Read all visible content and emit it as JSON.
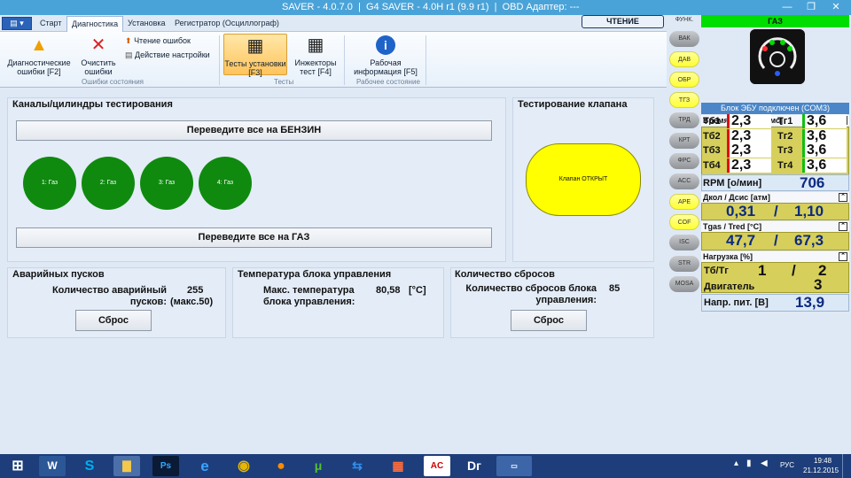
{
  "window": {
    "title": "SAVER - 4.0.7.0  |  G4 SAVER - 4.0H r1 (9.9 r1)  |  OBD Адаптер: ---"
  },
  "tabs": [
    "Старт",
    "Диагностика",
    "Установка",
    "Регистратор (Осциллограф)"
  ],
  "read_button": "ЧТЕНИЕ",
  "ribbon": {
    "diag_errors": "Диагностические ошибки [F2]",
    "clear_errors": "Очистить ошибки",
    "read_errors": "Чтение ошибок",
    "action_settings": "Действие настройки",
    "group_errors": "Ошибки состояния",
    "tests_install": "Тесты установки [F3]",
    "injectors_test": "Инжекторы тест [F4]",
    "group_tests": "Тесты",
    "work_info": "Рабочая информация [F5]",
    "group_work": "Рабочее состояние"
  },
  "channels": {
    "title": "Каналы/цилиндры тестирования",
    "to_petrol": "Переведите все на БЕНЗИН",
    "to_gas": "Переведите все на ГАЗ",
    "cylinders": [
      "1: Газ",
      "2: Газ",
      "3: Газ",
      "4: Газ"
    ],
    "cylinder_color": "#0f8a0f"
  },
  "valve": {
    "title": "Тестирование клапана",
    "state": "Клапан ОТКРЫТ",
    "color": "#ffff00"
  },
  "emergency": {
    "title": "Аварийных пусков",
    "label": "Количество аварийный пусков:",
    "value": "255",
    "max": "(макс.50)",
    "reset": "Сброс"
  },
  "temperature": {
    "title": "Температура блока управления",
    "label": "Макс. температура блока управления:",
    "value": "80,58",
    "unit": "[°C]"
  },
  "resets": {
    "title": "Количество сбросов",
    "label": "Количество сбросов блока управления:",
    "value": "85",
    "reset": "Сброс"
  },
  "side_buttons": [
    {
      "label": "ФУНК.",
      "style": "plain"
    },
    {
      "label": "ВАК",
      "style": "gray"
    },
    {
      "label": "ДАВ",
      "style": "yellow"
    },
    {
      "label": "ОБР",
      "style": "yellow"
    },
    {
      "label": "ТГЗ",
      "style": "yellow"
    },
    {
      "label": "ТРД",
      "style": "gray"
    },
    {
      "label": "КРТ",
      "style": "gray"
    },
    {
      "label": "ФРС",
      "style": "gray"
    },
    {
      "label": "АСС",
      "style": "gray"
    },
    {
      "label": "АРЕ",
      "style": "yellow"
    },
    {
      "label": "COF",
      "style": "yellow"
    },
    {
      "label": "ISC",
      "style": "gray"
    },
    {
      "label": "STR",
      "style": "gray"
    },
    {
      "label": "MOSA",
      "style": "gray"
    }
  ],
  "right": {
    "mode": "ГАЗ",
    "mode_color": "#00dd00",
    "ecu_status": "Блок ЭБУ подключен (COM3)",
    "inj_header": "Время впрыска [мс]",
    "inj": [
      {
        "lb": "Тб1",
        "vb": "2,3",
        "lg": "Тг1",
        "vg": "3,6"
      },
      {
        "lb": "Тб2",
        "vb": "2,3",
        "lg": "Тг2",
        "vg": "3,6"
      },
      {
        "lb": "Тб3",
        "vb": "2,3",
        "lg": "Тг3",
        "vg": "3,6"
      },
      {
        "lb": "Тб4",
        "vb": "2,3",
        "lg": "Тг4",
        "vg": "3,6"
      }
    ],
    "rpm_label": "RPM [о/мин]",
    "rpm": "706",
    "pressure_header": "Дкол / Дсис [атм]",
    "pcol": "0,31",
    "psys": "1,10",
    "temp_header": "Tgas / Tred [°C]",
    "tgas": "47,7",
    "tred": "67,3",
    "load_header": "Нагрузка [%]",
    "load_ratio_label": "Тб/Тг",
    "load_tb": "1",
    "load_tg": "2",
    "engine_label": "Двигатель",
    "engine_value": "3",
    "volt_label": "Напр. пит. [В]",
    "volt": "13,9",
    "separator": "/"
  },
  "taskbar": {
    "apps": [
      "Word",
      "Skype",
      "Проводник",
      "Photoshop",
      "Internet Explorer",
      "Chrome",
      "Firefox",
      "uTorrent",
      "TeamViewer",
      "Приложения",
      "AC",
      "Dг",
      "SAVER"
    ],
    "lang": "РУС",
    "time": "19:48",
    "date": "21.12.2015"
  }
}
